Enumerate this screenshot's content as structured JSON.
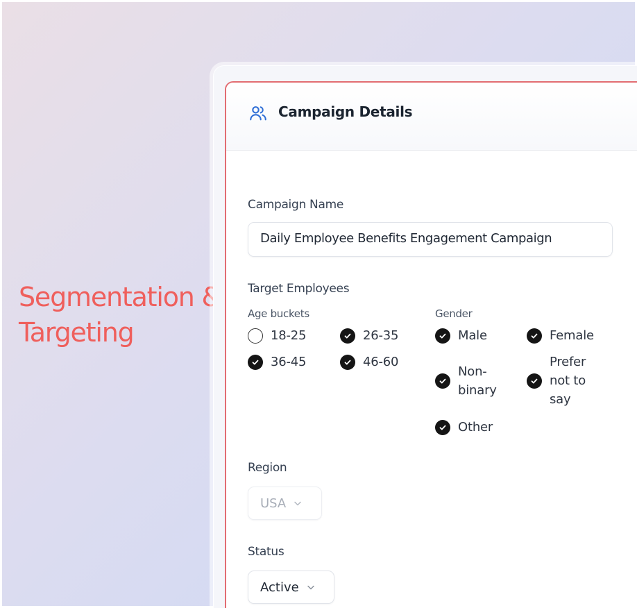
{
  "hero": {
    "line1": "Segmentation &",
    "line2": "Targeting"
  },
  "card": {
    "title": "Campaign Details",
    "icon": "users-icon"
  },
  "campaign_name": {
    "label": "Campaign Name",
    "value": "Daily Employee Benefits Engagement Campaign"
  },
  "target": {
    "label": "Target Employees",
    "age": {
      "label": "Age buckets",
      "options": [
        {
          "label": "18-25",
          "checked": false
        },
        {
          "label": "26-35",
          "checked": true
        },
        {
          "label": "36-45",
          "checked": true
        },
        {
          "label": "46-60",
          "checked": true
        }
      ]
    },
    "gender": {
      "label": "Gender",
      "options": [
        {
          "label": "Male",
          "checked": true
        },
        {
          "label": "Female",
          "checked": true
        },
        {
          "label": "Non-binary",
          "checked": true
        },
        {
          "label": "Prefer not to say",
          "checked": true
        },
        {
          "label": "Other",
          "checked": true
        }
      ]
    }
  },
  "region": {
    "label": "Region",
    "value": "USA",
    "disabled": true
  },
  "status": {
    "label": "Status",
    "value": "Active"
  },
  "colors": {
    "accent": "#ef5f5c",
    "card_border": "#e26d72",
    "check": "#151515"
  }
}
